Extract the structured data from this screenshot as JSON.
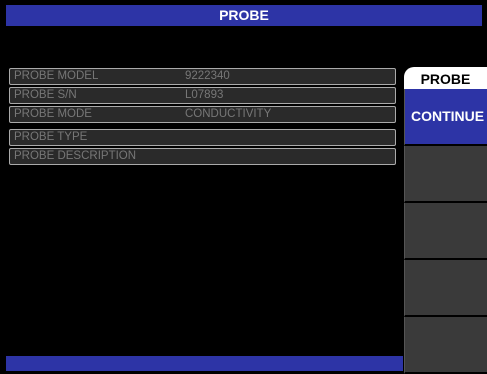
{
  "title": "PROBE",
  "info_rows": [
    {
      "label": "PROBE MODEL",
      "value": "9222340"
    },
    {
      "label": "PROBE S/N",
      "value": "L07893"
    },
    {
      "label": "PROBE MODE",
      "value": "CONDUCTIVITY"
    }
  ],
  "extra_rows": [
    {
      "label": "PROBE TYPE",
      "value": ""
    },
    {
      "label": "PROBE DESCRIPTION",
      "value": ""
    }
  ],
  "softkeys": {
    "title": "PROBE",
    "buttons": [
      "CONTINUE",
      "",
      "",
      "",
      ""
    ]
  },
  "colors": {
    "accent": "#2d34a6",
    "row_bg": "#2a2a2a",
    "row_text": "#777777"
  }
}
